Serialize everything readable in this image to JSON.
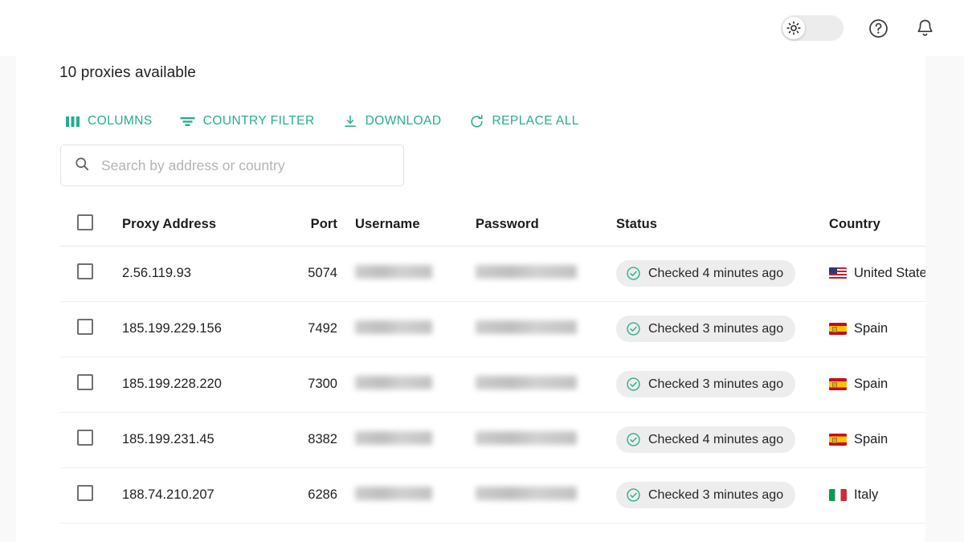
{
  "header": {
    "theme_toggle": {
      "icon": "sun-icon",
      "state": "light"
    },
    "help_icon": "help-circle-icon",
    "notifications_icon": "bell-icon"
  },
  "content": {
    "count_label": "10 proxies available",
    "toolbar": [
      {
        "label": "COLUMNS",
        "icon": "columns-icon"
      },
      {
        "label": "COUNTRY FILTER",
        "icon": "filter-icon"
      },
      {
        "label": "DOWNLOAD",
        "icon": "download-icon"
      },
      {
        "label": "REPLACE ALL",
        "icon": "refresh-icon"
      }
    ],
    "search": {
      "placeholder": "Search by address or country",
      "value": "",
      "icon": "search-icon"
    },
    "table": {
      "select_all_checkbox": "unchecked",
      "columns": [
        "Proxy Address",
        "Port",
        "Username",
        "Password",
        "Status",
        "Country"
      ],
      "rows": [
        {
          "selected": false,
          "address": "2.56.119.93",
          "port": "5074",
          "username": "",
          "password": "",
          "status": "Checked 4 minutes ago",
          "status_icon": "check-circle-icon",
          "country": "United States",
          "flag": "us"
        },
        {
          "selected": false,
          "address": "185.199.229.156",
          "port": "7492",
          "username": "",
          "password": "",
          "status": "Checked 3 minutes ago",
          "status_icon": "check-circle-icon",
          "country": "Spain",
          "flag": "es"
        },
        {
          "selected": false,
          "address": "185.199.228.220",
          "port": "7300",
          "username": "",
          "password": "",
          "status": "Checked 3 minutes ago",
          "status_icon": "check-circle-icon",
          "country": "Spain",
          "flag": "es"
        },
        {
          "selected": false,
          "address": "185.199.231.45",
          "port": "8382",
          "username": "",
          "password": "",
          "status": "Checked 4 minutes ago",
          "status_icon": "check-circle-icon",
          "country": "Spain",
          "flag": "es"
        },
        {
          "selected": false,
          "address": "188.74.210.207",
          "port": "6286",
          "username": "",
          "password": "",
          "status": "Checked 3 minutes ago",
          "status_icon": "check-circle-icon",
          "country": "Italy",
          "flag": "it"
        }
      ]
    }
  },
  "colors": {
    "accent": "#27ae8f",
    "status_ok": "#2bb08d",
    "text": "#1c1c1c",
    "page_bg": "#f9f9f9",
    "card_bg": "#ffffff",
    "pill_bg": "#ededed"
  }
}
